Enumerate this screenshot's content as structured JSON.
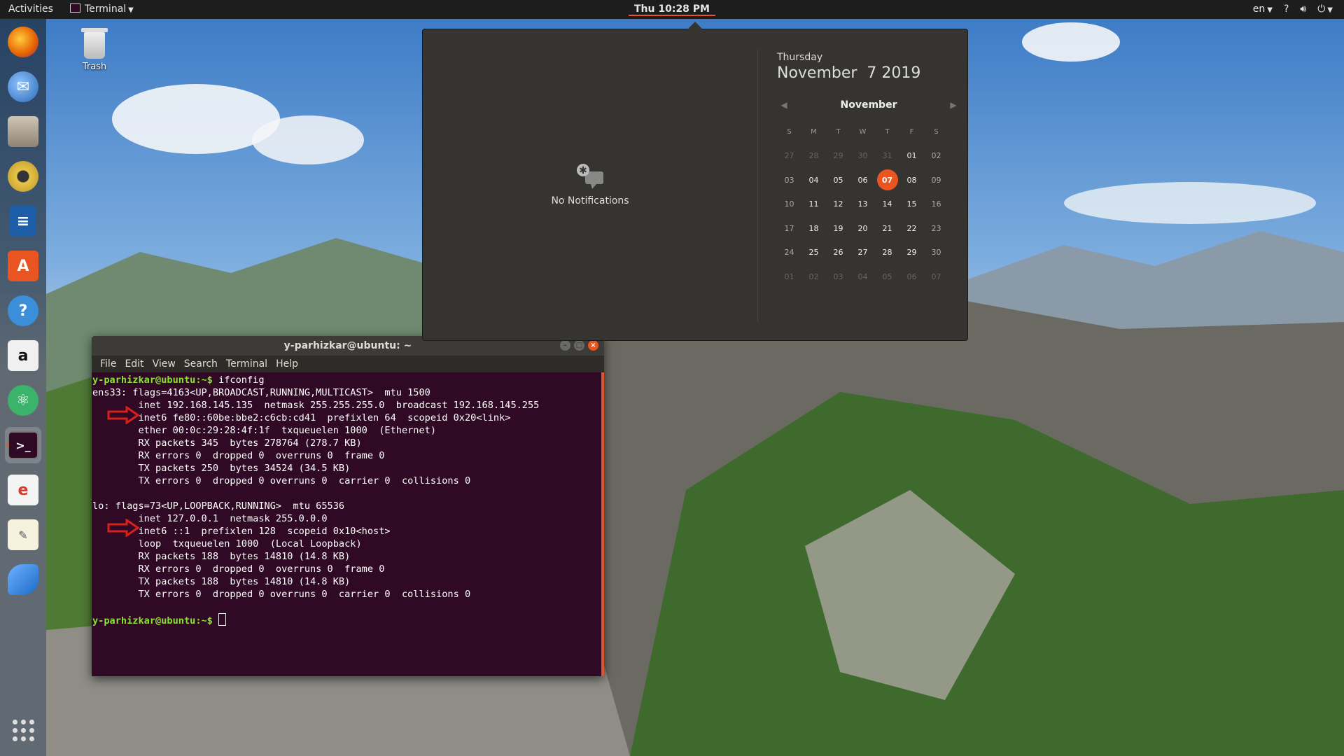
{
  "topbar": {
    "activities": "Activities",
    "app_menu": "Terminal",
    "clock": "Thu 10:28 PM",
    "language": "en"
  },
  "desktop": {
    "trash_label": "Trash"
  },
  "dock": {
    "items": [
      {
        "name": "firefox-icon",
        "color": "#e66000"
      },
      {
        "name": "thunderbird-icon",
        "color": "#2a6ab5"
      },
      {
        "name": "files-icon",
        "color": "#9a8c7a"
      },
      {
        "name": "rhythmbox-icon",
        "color": "#e8c547"
      },
      {
        "name": "libreoffice-writer-icon",
        "color": "#1e5ea8"
      },
      {
        "name": "software-center-icon",
        "color": "#e95420"
      },
      {
        "name": "help-icon",
        "color": "#3a8fd8"
      },
      {
        "name": "amazon-icon",
        "color": "#f0f0f0"
      },
      {
        "name": "atom-icon",
        "color": "#3bb36a"
      },
      {
        "name": "terminal-icon",
        "color": "#300a24"
      },
      {
        "name": "document-viewer-icon",
        "color": "#d83a2a"
      },
      {
        "name": "text-editor-icon",
        "color": "#f5f1dc"
      },
      {
        "name": "wireshark-icon",
        "color": "#1a6bc6"
      }
    ],
    "show_apps": "show-applications-icon"
  },
  "notifications": {
    "empty_label": "No Notifications"
  },
  "calendar": {
    "weekday": "Thursday",
    "date": "November  7 2019",
    "month": "November",
    "weekday_headers": [
      "S",
      "M",
      "T",
      "W",
      "T",
      "F",
      "S"
    ],
    "weeks": [
      [
        "27",
        "28",
        "29",
        "30",
        "31",
        "01",
        "02"
      ],
      [
        "03",
        "04",
        "05",
        "06",
        "07",
        "08",
        "09"
      ],
      [
        "10",
        "11",
        "12",
        "13",
        "14",
        "15",
        "16"
      ],
      [
        "17",
        "18",
        "19",
        "20",
        "21",
        "22",
        "23"
      ],
      [
        "24",
        "25",
        "26",
        "27",
        "28",
        "29",
        "30"
      ],
      [
        "01",
        "02",
        "03",
        "04",
        "05",
        "06",
        "07"
      ]
    ],
    "today": "07"
  },
  "terminal": {
    "title": "y-parhizkar@ubuntu: ~",
    "menu": [
      "File",
      "Edit",
      "View",
      "Search",
      "Terminal",
      "Help"
    ],
    "lines": [
      {
        "prompt": "y-parhizkar@ubuntu:~$ ",
        "text": "ifconfig"
      },
      {
        "prompt": "",
        "text": "ens33: flags=4163<UP,BROADCAST,RUNNING,MULTICAST>  mtu 1500"
      },
      {
        "prompt": "",
        "text": "        inet 192.168.145.135  netmask 255.255.255.0  broadcast 192.168.145.255"
      },
      {
        "prompt": "",
        "text": "        inet6 fe80::60be:bbe2:c6cb:cd41  prefixlen 64  scopeid 0x20<link>"
      },
      {
        "prompt": "",
        "text": "        ether 00:0c:29:28:4f:1f  txqueuelen 1000  (Ethernet)"
      },
      {
        "prompt": "",
        "text": "        RX packets 345  bytes 278764 (278.7 KB)"
      },
      {
        "prompt": "",
        "text": "        RX errors 0  dropped 0  overruns 0  frame 0"
      },
      {
        "prompt": "",
        "text": "        TX packets 250  bytes 34524 (34.5 KB)"
      },
      {
        "prompt": "",
        "text": "        TX errors 0  dropped 0 overruns 0  carrier 0  collisions 0"
      },
      {
        "prompt": "",
        "text": ""
      },
      {
        "prompt": "",
        "text": "lo: flags=73<UP,LOOPBACK,RUNNING>  mtu 65536"
      },
      {
        "prompt": "",
        "text": "        inet 127.0.0.1  netmask 255.0.0.0"
      },
      {
        "prompt": "",
        "text": "        inet6 ::1  prefixlen 128  scopeid 0x10<host>"
      },
      {
        "prompt": "",
        "text": "        loop  txqueuelen 1000  (Local Loopback)"
      },
      {
        "prompt": "",
        "text": "        RX packets 188  bytes 14810 (14.8 KB)"
      },
      {
        "prompt": "",
        "text": "        RX errors 0  dropped 0  overruns 0  frame 0"
      },
      {
        "prompt": "",
        "text": "        TX packets 188  bytes 14810 (14.8 KB)"
      },
      {
        "prompt": "",
        "text": "        TX errors 0  dropped 0 overruns 0  carrier 0  collisions 0"
      },
      {
        "prompt": "",
        "text": ""
      },
      {
        "prompt": "y-parhizkar@ubuntu:~$ ",
        "text": "",
        "cursor": true
      }
    ],
    "annotation_color": "#d9201a"
  }
}
